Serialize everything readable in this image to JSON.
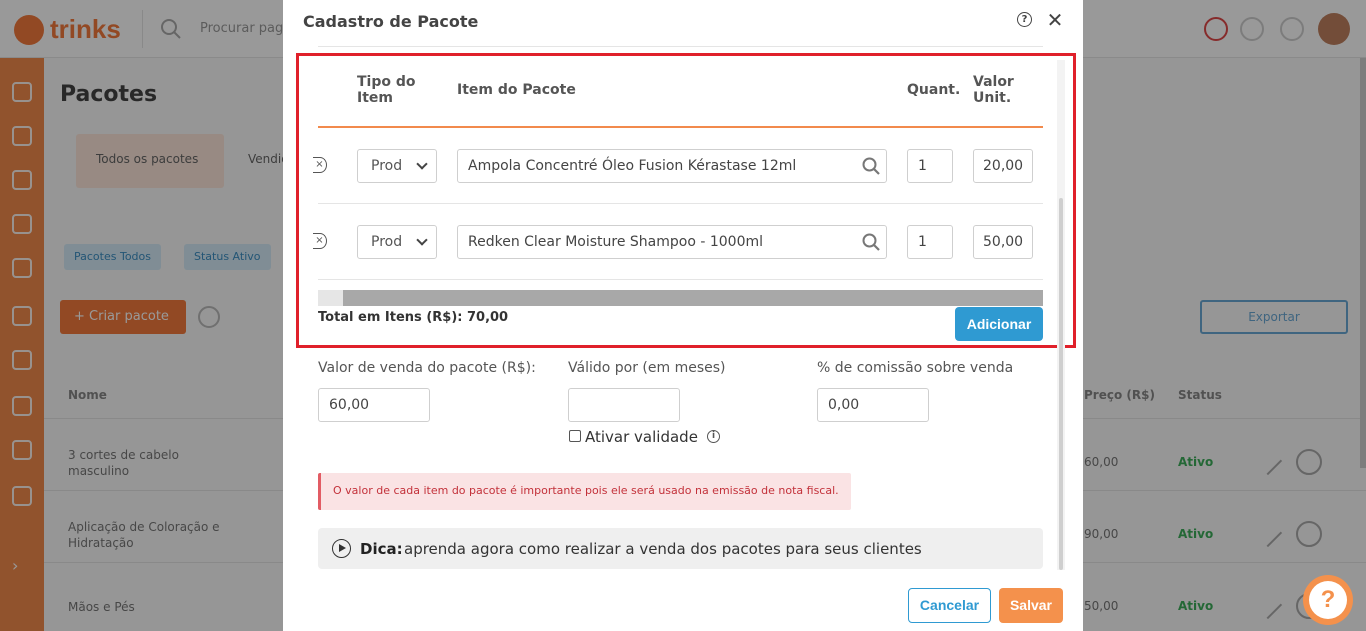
{
  "background": {
    "logo_text": "trinks",
    "search_placeholder": "Procurar pagamento",
    "page_title": "Pacotes",
    "tab_active": "Todos os pacotes",
    "tab_other": "Vendidos",
    "chips": [
      "Pacotes Todos",
      "Status Ativo"
    ],
    "create_button": "+ Criar pacote",
    "export_button": "Exportar",
    "columns": [
      "Nome",
      "Preço (R$)",
      "Status"
    ],
    "rows": [
      {
        "name": "3 cortes de cabelo masculino",
        "price": "60,00",
        "status": "Ativo"
      },
      {
        "name": "Aplicação de Coloração e Hidratação",
        "price": "90,00",
        "status": "Ativo"
      },
      {
        "name": "Mãos e Pés",
        "price": "50,00",
        "status": "Ativo"
      }
    ]
  },
  "modal": {
    "title": "Cadastro de Pacote",
    "help_glyph": "?",
    "close_glyph": "✕",
    "table": {
      "headers": {
        "tipo_line1": "Tipo do",
        "tipo_line2": "Item",
        "item": "Item do Pacote",
        "quant": "Quant.",
        "valor_line1": "Valor",
        "valor_line2": "Unit."
      },
      "rows": [
        {
          "tipo": "Prod",
          "item": "Ampola Concentré Óleo Fusion Kérastase 12ml",
          "quant": "1",
          "valor": "20,00"
        },
        {
          "tipo": "Prod",
          "item": "Redken Clear Moisture Shampoo - 1000ml",
          "quant": "1",
          "valor": "50,00"
        }
      ]
    },
    "total_label": "Total em Itens (R$): 70,00",
    "add_button": "Adicionar",
    "fields": {
      "valor_venda_label": "Valor de venda do pacote (R$):",
      "valor_venda_value": "60,00",
      "validade_label": "Válido por (em meses)",
      "validade_value": "",
      "comissao_label": "% de comissão sobre venda",
      "comissao_value": "0,00",
      "ativar_label": "Ativar validade",
      "info_glyph": "i"
    },
    "alert_text": "O valor de cada item do pacote é importante pois ele será usado na emissão de nota fiscal.",
    "tip_bold": "Dica:",
    "tip_text": "aprenda agora como realizar a venda dos pacotes para seus clientes",
    "cancel_button": "Cancelar",
    "save_button": "Salvar"
  },
  "help_fab_glyph": "?",
  "colors": {
    "accent_orange": "#f4914c",
    "primary_blue": "#2f9ad2",
    "highlight_red": "#e0202a",
    "alert_text": "#c3313a"
  }
}
